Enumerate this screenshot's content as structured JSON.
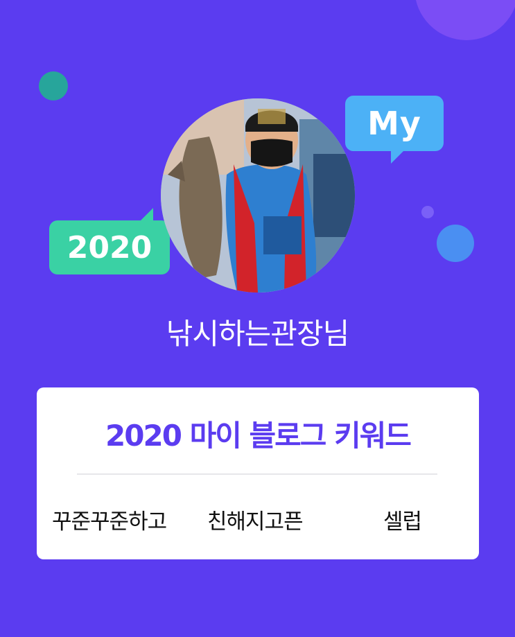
{
  "colors": {
    "background": "#5b3cf0",
    "accent": "#5b3cf0",
    "bubble_my": "#4cb1f6",
    "bubble_2020": "#3ad1a4",
    "card": "#ffffff"
  },
  "bubbles": {
    "my_label": "My",
    "year_label": "2020"
  },
  "profile": {
    "avatar_alt": "profile-photo",
    "username": "낚시하는관장님"
  },
  "card": {
    "title": "2020 마이 블로그 키워드",
    "keywords": [
      "꾸준꾸준하고",
      "친해지고픈",
      "셀럽"
    ]
  }
}
